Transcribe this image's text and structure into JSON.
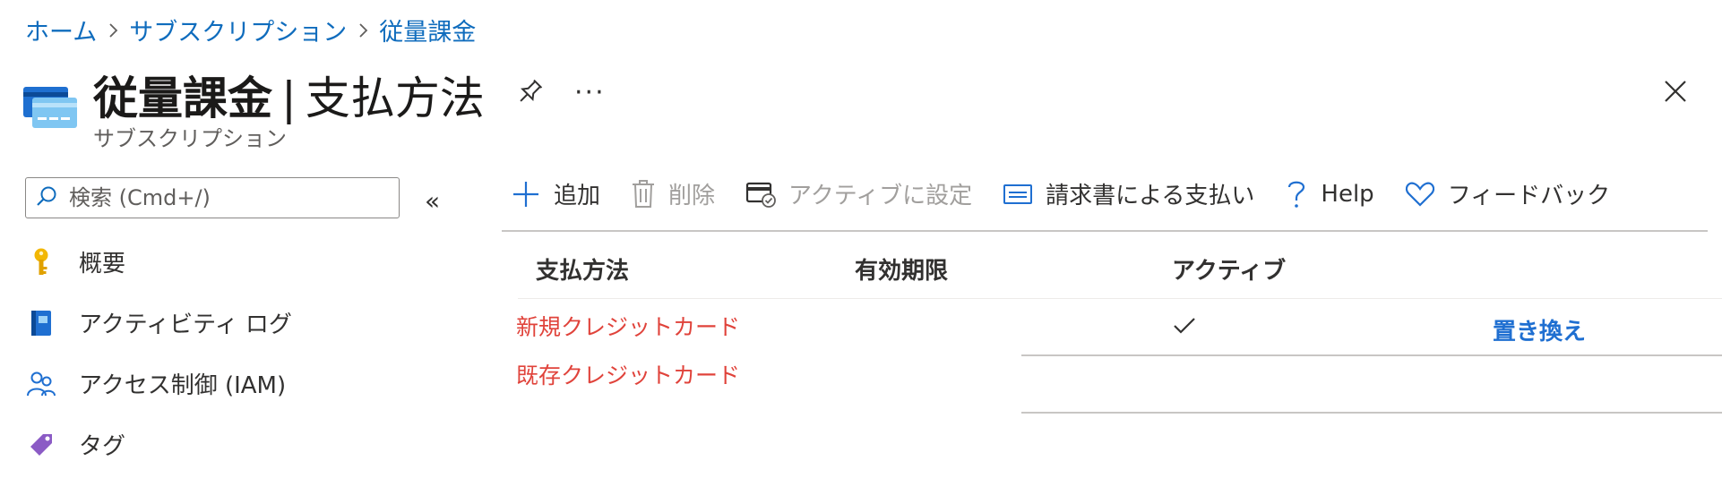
{
  "breadcrumb": {
    "items": [
      "ホーム",
      "サブスクリプション",
      "従量課金"
    ]
  },
  "header": {
    "title_main": "従量課金",
    "title_separator": "|",
    "title_sub": "支払方法",
    "subtitle": "サブスクリプション",
    "more_label": "···"
  },
  "sidebar": {
    "search_placeholder": "検索 (Cmd+/)",
    "collapse_label": "«",
    "items": [
      {
        "label": "概要",
        "icon": "key-icon"
      },
      {
        "label": "アクティビティ ログ",
        "icon": "log-book-icon"
      },
      {
        "label": "アクセス制御 (IAM)",
        "icon": "people-icon"
      },
      {
        "label": "タグ",
        "icon": "tag-icon"
      }
    ]
  },
  "toolbar": {
    "add": "追加",
    "delete": "削除",
    "set_active": "アクティブに設定",
    "pay_by_invoice": "請求書による支払い",
    "help": "Help",
    "feedback": "フィードバック"
  },
  "table": {
    "columns": [
      "支払方法",
      "有効期限",
      "アクティブ"
    ],
    "links": [
      "新規クレジットカード",
      "既存クレジットカード"
    ],
    "replace_label": "置き換え"
  },
  "colors": {
    "link_blue": "#0f6cbd",
    "accent_red": "#e0433b",
    "action_blue": "#1f6fd1"
  }
}
